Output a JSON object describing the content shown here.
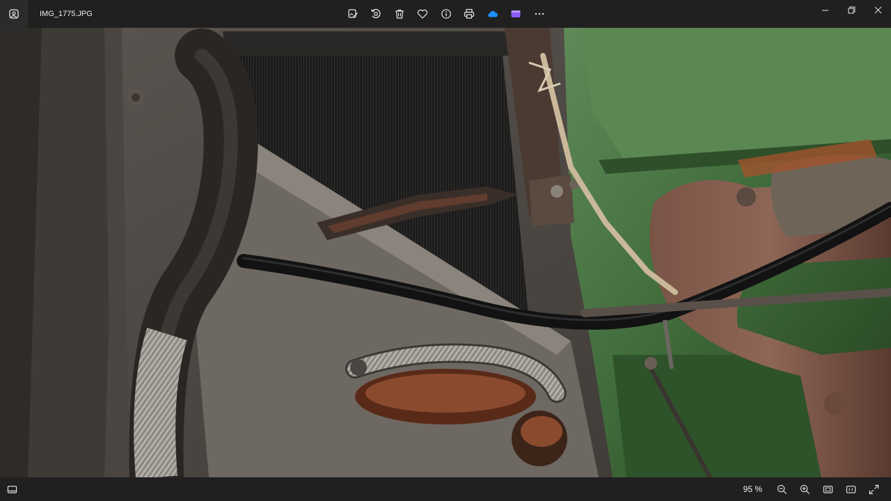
{
  "window": {
    "file_name": "IMG_1775.JPG",
    "app_icon": "photos-app-icon"
  },
  "toolbar": {
    "buttons": [
      {
        "icon": "edit-image-icon",
        "label": "Edit image"
      },
      {
        "icon": "rotate-icon",
        "label": "Rotate"
      },
      {
        "icon": "delete-icon",
        "label": "Delete"
      },
      {
        "icon": "favorite-heart-icon",
        "label": "Favorite"
      },
      {
        "icon": "file-info-icon",
        "label": "File info"
      },
      {
        "icon": "print-icon",
        "label": "Print"
      },
      {
        "icon": "onedrive-cloud-icon",
        "label": "OneDrive",
        "color": "#1e90ff"
      },
      {
        "icon": "clipchamp-icon",
        "label": "Clipchamp",
        "color": "#8b5cf6"
      },
      {
        "icon": "more-options-icon",
        "label": "See more"
      }
    ]
  },
  "window_controls": [
    "minimize-icon",
    "restore-icon",
    "close-icon"
  ],
  "statusbar": {
    "zoom_level": "95 %",
    "buttons": [
      "zoom-out-icon",
      "zoom-in-icon",
      "fit-to-window-icon",
      "actual-size-icon",
      "fullscreen-icon"
    ]
  },
  "colors": {
    "chrome_bg": "#202020",
    "engine_green": "#3f6a3a",
    "hose_black": "#1a1a1a",
    "rust": "#6b3f2a"
  }
}
